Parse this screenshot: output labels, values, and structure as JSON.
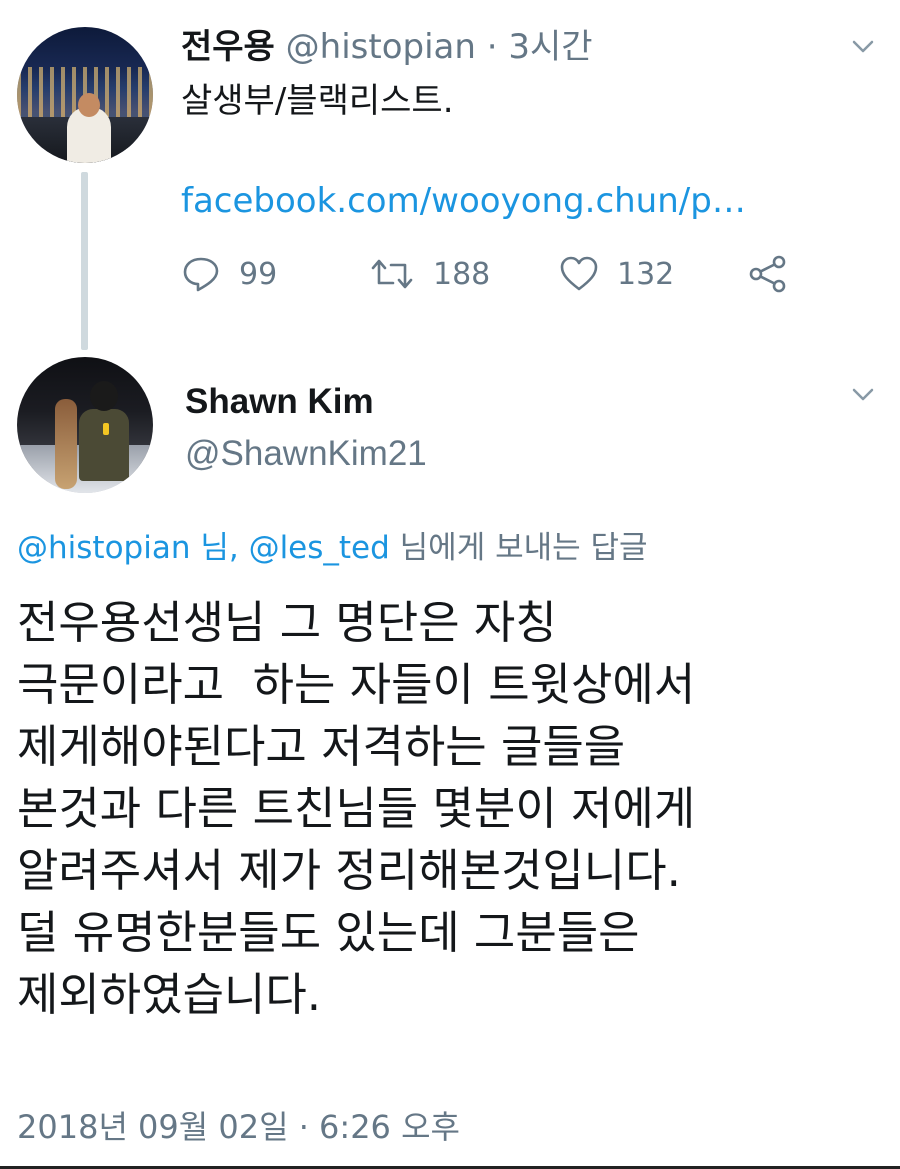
{
  "parent_tweet": {
    "display_name": "전우용",
    "handle": "@histopian",
    "separator": "·",
    "time_ago": "3시간",
    "text": "살생부/블랙리스트.",
    "link": "facebook.com/wooyong.chun/p…",
    "actions": {
      "reply_count": "99",
      "retweet_count": "188",
      "like_count": "132"
    }
  },
  "reply_tweet": {
    "display_name": "Shawn Kim",
    "handle": "@ShawnKim21",
    "replying_to": {
      "mention_1": "@histopian 님",
      "comma": ", ",
      "mention_2": "@les_ted",
      "suffix": " 님에게 보내는 답글"
    },
    "body_lines": [
      "전우용선생님 그 명단은 자칭",
      "극문이라고  하는 자들이 트윗상에서",
      "제게해야된다고 저격하는 글들을",
      "본것과 다른 트친님들 몇분이 저에게",
      "알려주셔서 제가 정리해본것입니다.",
      "덜 유명한분들도 있는데 그분들은",
      "제외하였습니다."
    ],
    "timestamp": "2018년 09월 02일 · 6:26 오후"
  },
  "colors": {
    "text_primary": "#14171a",
    "text_secondary": "#657786",
    "link_blue": "#1b95e0",
    "thread_line": "#cfd9de"
  }
}
